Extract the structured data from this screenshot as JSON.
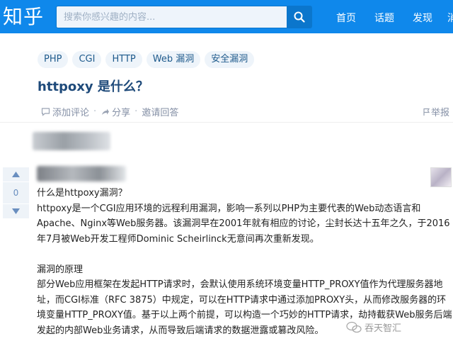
{
  "header": {
    "logo": "知乎",
    "search_placeholder": "搜索你感兴趣的内容...",
    "nav": [
      "首页",
      "话题",
      "发现",
      "消"
    ]
  },
  "question": {
    "tags": [
      "PHP",
      "CGI",
      "HTTP",
      "Web 漏洞",
      "安全漏洞"
    ],
    "title": "httpoxy 是什么？",
    "actions": {
      "comment": "添加评论",
      "share": "分享",
      "invite": "邀请回答",
      "report": "举报",
      "sep": "·"
    }
  },
  "answer": {
    "votes": "0",
    "paragraphs": [
      "什么是httpoxy漏洞？",
      "httpoxy是一个CGI应用环境的远程利用漏洞，影响一系列以PHP为主要代表的Web动态语言和Apache、Nginx等Web服务器。该漏洞早在2001年就有相应的讨论，尘封长达十五年之久，于2016年7月被Web开发工程师Dominic Scheirlinck无意间再次重新发现。",
      "",
      "漏洞的原理",
      "部分Web应用框架在发起HTTP请求时，会默认使用系统环境变量HTTP_PROXY值作为代理服务器地址，而CGI标准（RFC 3875）中规定，可以在HTTP请求中通过添加PROXY头，从而修改服务器的环境变量HTTP_PROXY值。基于以上两个前提，可以构造一个巧妙的HTTP请求，劫持截获Web服务后端发起的内部Web业务请求，从而导致后端请求的数据泄露或篡改风险。"
    ]
  },
  "watermark": "吞天智汇",
  "colors": {
    "brand": "#0f88eb",
    "title": "#1e4a7a",
    "tag_bg": "#eef4fa",
    "muted": "#8590a6"
  }
}
